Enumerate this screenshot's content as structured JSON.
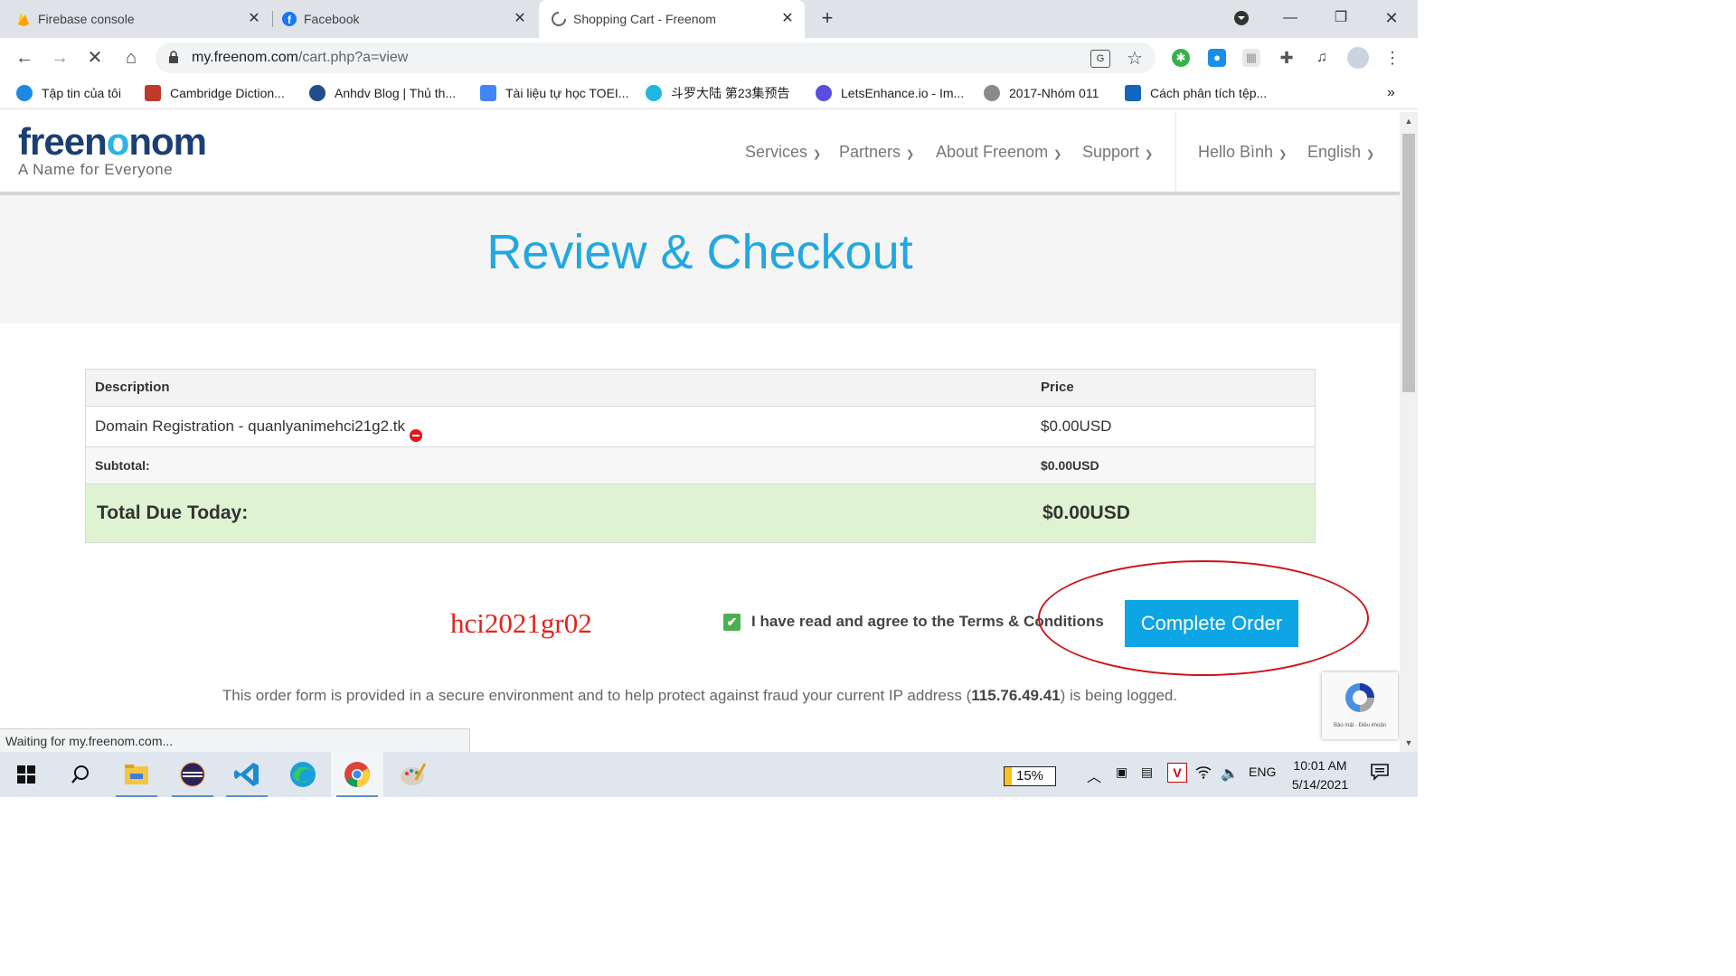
{
  "browser": {
    "tabs": [
      {
        "title": "Firebase console",
        "icon": "firebase-icon"
      },
      {
        "title": "Facebook",
        "icon": "facebook-icon"
      },
      {
        "title": "Shopping Cart - Freenom",
        "icon": "loading-spinner-icon",
        "active": true
      }
    ],
    "url_host": "my.freenom.com",
    "url_path": "/cart.php?a=view",
    "bookmarks": [
      "Tập tin của tôi",
      "Cambridge Diction...",
      "Anhdv Blog | Thủ th...",
      "Tài liệu tự học TOEI...",
      "斗罗大陆 第23集预告",
      "LetsEnhance.io - Im...",
      "2017-Nhóm 011",
      "Cách phân tích tệp..."
    ],
    "bookmarks_overflow": "»",
    "status_text": "Waiting for my.freenom.com..."
  },
  "site": {
    "logo": {
      "pre": "free",
      "o": "o",
      "post": "nom",
      "n_after_e": "n",
      "tagline": "A Name for Everyone"
    },
    "menu": [
      "Services",
      "Partners",
      "About Freenom",
      "Support"
    ],
    "user_menu": "Hello Bình",
    "language": "English",
    "hero_title": "Review & Checkout"
  },
  "cart": {
    "headers": {
      "description": "Description",
      "price": "Price"
    },
    "item": {
      "description": "Domain Registration - quanlyanimehci21g2.tk",
      "price": "$0.00USD"
    },
    "subtotal": {
      "label": "Subtotal:",
      "value": "$0.00USD"
    },
    "total": {
      "label": "Total Due Today:",
      "value": "$0.00USD"
    }
  },
  "checkout": {
    "watermark": "hci2021gr02",
    "agree_label": "I have read and agree to the Terms & Conditions",
    "agree_checked": true,
    "complete_button": "Complete Order",
    "secure_pre": "This order form is provided in a secure environment and to help protect against fraud your current IP address (",
    "ip": "115.76.49.41",
    "secure_post": ") is being logged.",
    "recaptcha_text": "Bảo mật - Điều khoản"
  },
  "taskbar": {
    "battery_percent": 15,
    "battery_label": "15%",
    "language": "ENG",
    "time": "10:01 AM",
    "date": "5/14/2021"
  },
  "colors": {
    "brand_blue": "#22a8e0",
    "button_blue": "#0ea5e4",
    "total_bg": "#dff3d3",
    "annotation_red": "#e2231a"
  }
}
